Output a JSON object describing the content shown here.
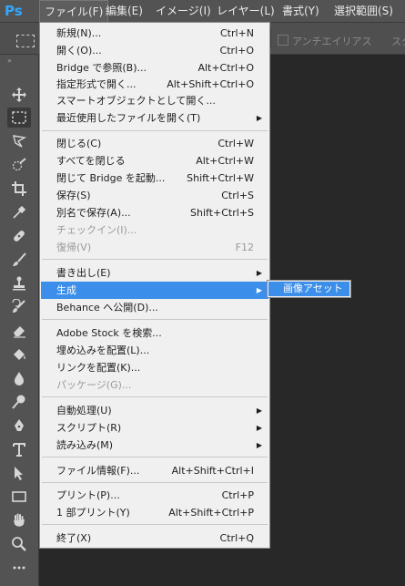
{
  "menubar": {
    "logo": "Ps",
    "items": [
      "ファイル(F)",
      "編集(E)",
      "イメージ(I)",
      "レイヤー(L)",
      "書式(Y)",
      "選択範囲(S)"
    ]
  },
  "options": {
    "antialias": "アンチエイリアス",
    "style": "スタ"
  },
  "tools": [
    "move-tool",
    "marquee-tool",
    "lasso-tool",
    "quick-select-tool",
    "crop-tool",
    "eyedropper-tool",
    "healing-brush-tool",
    "brush-tool",
    "clone-stamp-tool",
    "history-brush-tool",
    "eraser-tool",
    "paint-bucket-tool",
    "blur-tool",
    "dodge-tool",
    "pen-tool",
    "type-tool",
    "path-select-tool",
    "rectangle-tool",
    "hand-tool",
    "zoom-tool",
    "more-tools"
  ],
  "menu": {
    "items": [
      {
        "label": "新規(N)...",
        "shortcut": "Ctrl+N"
      },
      {
        "label": "開く(O)...",
        "shortcut": "Ctrl+O"
      },
      {
        "label": "Bridge で参照(B)...",
        "shortcut": "Alt+Ctrl+O"
      },
      {
        "label": "指定形式で開く...",
        "shortcut": "Alt+Shift+Ctrl+O"
      },
      {
        "label": "スマートオブジェクトとして開く...",
        "shortcut": ""
      },
      {
        "label": "最近使用したファイルを開く(T)",
        "shortcut": ""
      },
      {
        "label": "閉じる(C)",
        "shortcut": "Ctrl+W"
      },
      {
        "label": "すべてを閉じる",
        "shortcut": "Alt+Ctrl+W"
      },
      {
        "label": "閉じて Bridge を起動...",
        "shortcut": "Shift+Ctrl+W"
      },
      {
        "label": "保存(S)",
        "shortcut": "Ctrl+S"
      },
      {
        "label": "別名で保存(A)...",
        "shortcut": "Shift+Ctrl+S"
      },
      {
        "label": "チェックイン(I)...",
        "shortcut": ""
      },
      {
        "label": "復帰(V)",
        "shortcut": "F12"
      },
      {
        "label": "書き出し(E)",
        "shortcut": ""
      },
      {
        "label": "生成",
        "shortcut": ""
      },
      {
        "label": "Behance へ公開(D)...",
        "shortcut": ""
      },
      {
        "label": "Adobe Stock を検索...",
        "shortcut": ""
      },
      {
        "label": "埋め込みを配置(L)...",
        "shortcut": ""
      },
      {
        "label": "リンクを配置(K)...",
        "shortcut": ""
      },
      {
        "label": "パッケージ(G)...",
        "shortcut": ""
      },
      {
        "label": "自動処理(U)",
        "shortcut": ""
      },
      {
        "label": "スクリプト(R)",
        "shortcut": ""
      },
      {
        "label": "読み込み(M)",
        "shortcut": ""
      },
      {
        "label": "ファイル情報(F)...",
        "shortcut": "Alt+Shift+Ctrl+I"
      },
      {
        "label": "プリント(P)...",
        "shortcut": "Ctrl+P"
      },
      {
        "label": "1 部プリント(Y)",
        "shortcut": "Alt+Shift+Ctrl+P"
      },
      {
        "label": "終了(X)",
        "shortcut": "Ctrl+Q"
      }
    ]
  },
  "submenu": {
    "items": [
      "画像アセット"
    ]
  }
}
